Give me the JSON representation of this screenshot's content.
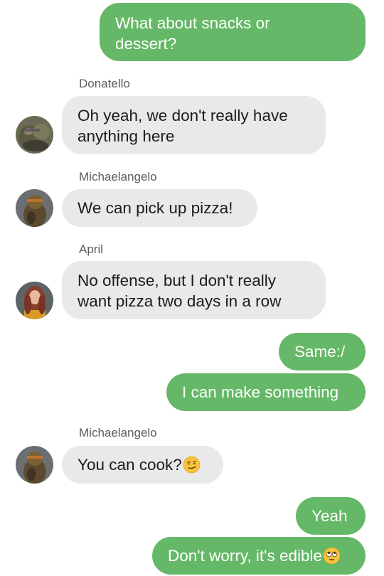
{
  "conversation": {
    "messages": [
      {
        "direction": "outgoing",
        "text": "What about snacks or\ndessert?"
      },
      {
        "direction": "incoming",
        "sender": "Donatello",
        "avatar": "donatello-avatar",
        "text": "Oh yeah, we don't really have\nanything here"
      },
      {
        "direction": "incoming",
        "sender": "Michaelangelo",
        "avatar": "michaelangelo-avatar",
        "text": "We can pick up pizza!"
      },
      {
        "direction": "incoming",
        "sender": "April",
        "avatar": "april-avatar",
        "text": "No offense, but I don't really\nwant pizza two days in a row"
      },
      {
        "direction": "outgoing",
        "text": "Same:/"
      },
      {
        "direction": "outgoing",
        "text": "I can make something"
      },
      {
        "direction": "incoming",
        "sender": "Michaelangelo",
        "avatar": "michaelangelo-avatar",
        "text": "You can cook?",
        "emoji": "smirking-face-emoji"
      },
      {
        "direction": "outgoing",
        "text": "Yeah"
      },
      {
        "direction": "outgoing",
        "text": "Don't worry, it's edible",
        "emoji": "face-with-rolling-eyes-emoji"
      }
    ]
  },
  "colors": {
    "outgoing_bubble": "#65b867",
    "incoming_bubble": "#e9e9e9",
    "sender_name": "#5c5c5c"
  }
}
